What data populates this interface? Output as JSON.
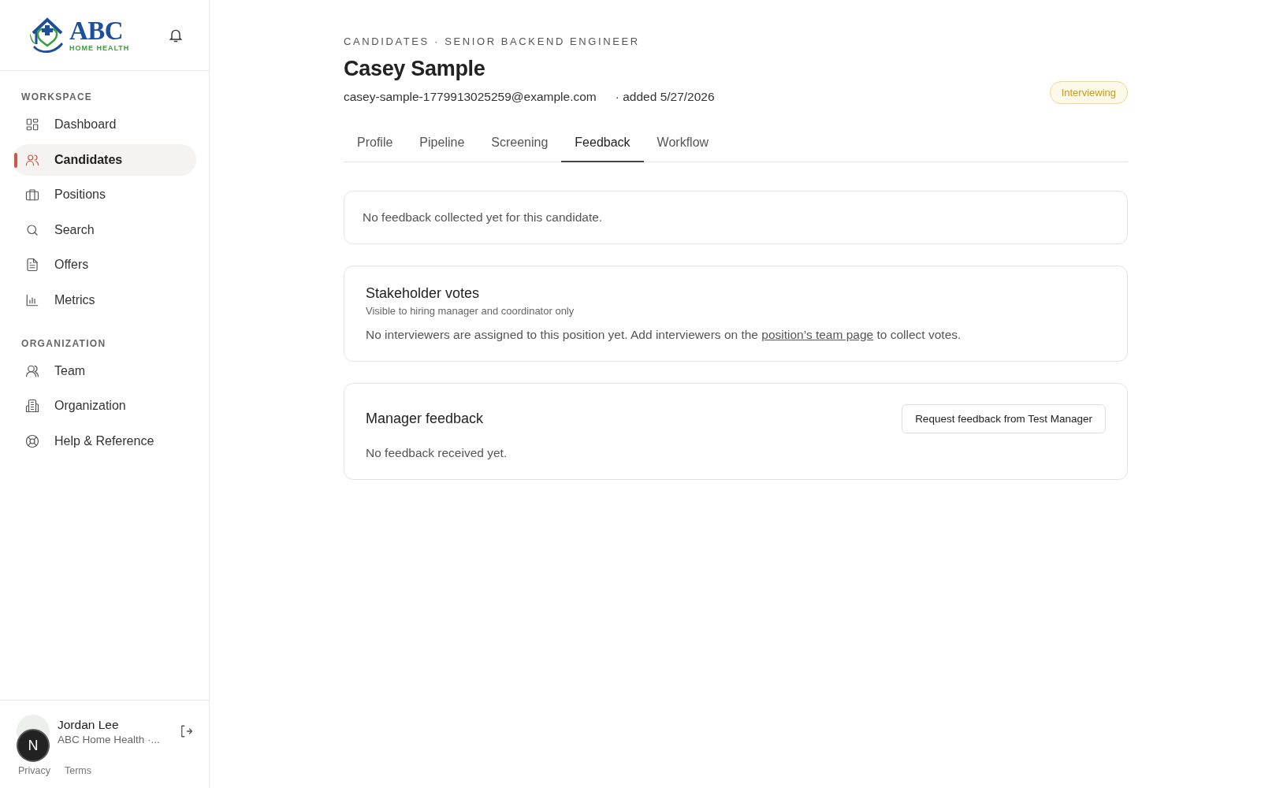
{
  "sidebar": {
    "logo": {
      "word": "ABC",
      "tagline": "HOME HEALTH"
    },
    "sections": [
      {
        "label": "WORKSPACE",
        "items": [
          {
            "label": "Dashboard",
            "selected": false
          },
          {
            "label": "Candidates",
            "selected": true
          },
          {
            "label": "Positions",
            "selected": false
          },
          {
            "label": "Search",
            "selected": false
          },
          {
            "label": "Offers",
            "selected": false
          },
          {
            "label": "Metrics",
            "selected": false
          }
        ]
      },
      {
        "label": "ORGANIZATION",
        "items": [
          {
            "label": "Team",
            "selected": false
          },
          {
            "label": "Organization",
            "selected": false
          },
          {
            "label": "Help & Reference",
            "selected": false
          }
        ]
      }
    ],
    "user": {
      "name": "Jordan Lee",
      "org": "ABC Home Health ·..."
    },
    "footer_links": [
      "Privacy",
      "Terms"
    ],
    "dev_badge": "N"
  },
  "header": {
    "breadcrumb": "CANDIDATES · SENIOR BACKEND ENGINEER",
    "name": "Casey Sample",
    "email": "casey-sample-1779913025259@example.com",
    "added": "· added 5/27/2026",
    "status": "Interviewing"
  },
  "tabs": [
    {
      "label": "Profile",
      "selected": false
    },
    {
      "label": "Pipeline",
      "selected": false
    },
    {
      "label": "Screening",
      "selected": false
    },
    {
      "label": "Feedback",
      "selected": true
    },
    {
      "label": "Workflow",
      "selected": false
    }
  ],
  "cards": [
    {
      "kind": "message",
      "text": "No feedback collected yet for this candidate."
    },
    {
      "kind": "votes",
      "title": "Stakeholder votes",
      "subtitle": "Visible to hiring manager and coordinator only",
      "text_before": "No interviewers are assigned to this position yet. Add interviewers on the ",
      "link": "position’s team page",
      "text_after": " to collect votes."
    },
    {
      "kind": "manager",
      "title": "Manager feedback",
      "button": "Request feedback from Test Manager",
      "text": "No feedback received yet."
    }
  ]
}
